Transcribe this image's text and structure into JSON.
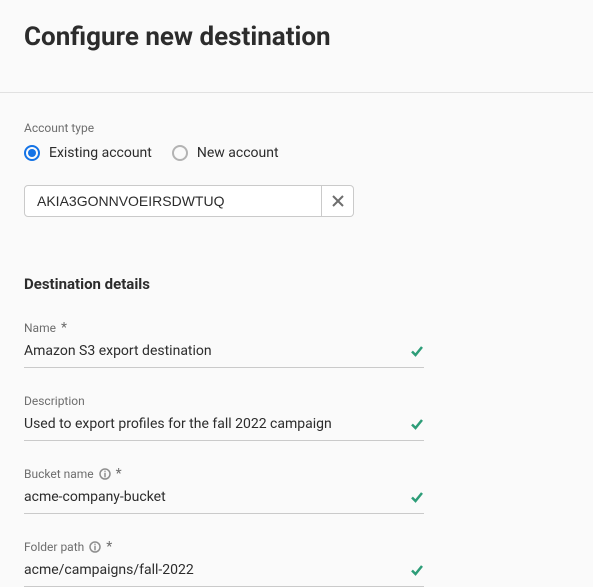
{
  "title": "Configure new destination",
  "account": {
    "label": "Account type",
    "options": {
      "existing": "Existing account",
      "new": "New account"
    },
    "value": "AKIA3GONNVOEIRSDWTUQ"
  },
  "details": {
    "heading": "Destination details",
    "name": {
      "label": "Name",
      "value": "Amazon S3 export destination"
    },
    "description": {
      "label": "Description",
      "value": "Used to export profiles for the fall 2022 campaign"
    },
    "bucket": {
      "label": "Bucket name",
      "value": "acme-company-bucket"
    },
    "folder": {
      "label": "Folder path",
      "value": "acme/campaigns/fall-2022"
    }
  }
}
